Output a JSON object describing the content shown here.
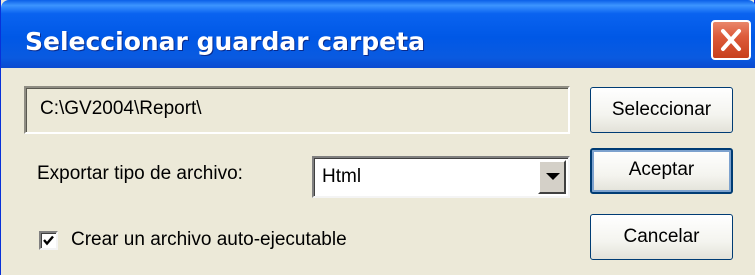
{
  "window": {
    "title": "Seleccionar guardar carpeta",
    "close_icon": "close-icon"
  },
  "path": {
    "value": "C:\\GV2004\\Report\\"
  },
  "buttons": {
    "select_label": "Seleccionar",
    "accept_label": "Aceptar",
    "cancel_label": "Cancelar"
  },
  "export": {
    "label": "Exportar tipo de archivo:",
    "selected_value": "Html",
    "dropdown_icon": "chevron-down-icon"
  },
  "autoexec": {
    "label": "Crear un archivo auto-ejecutable",
    "checked": true
  },
  "colors": {
    "titlebar": "#0058e6",
    "close_button": "#dd5b3b",
    "dialog_background": "#ece9d8"
  }
}
